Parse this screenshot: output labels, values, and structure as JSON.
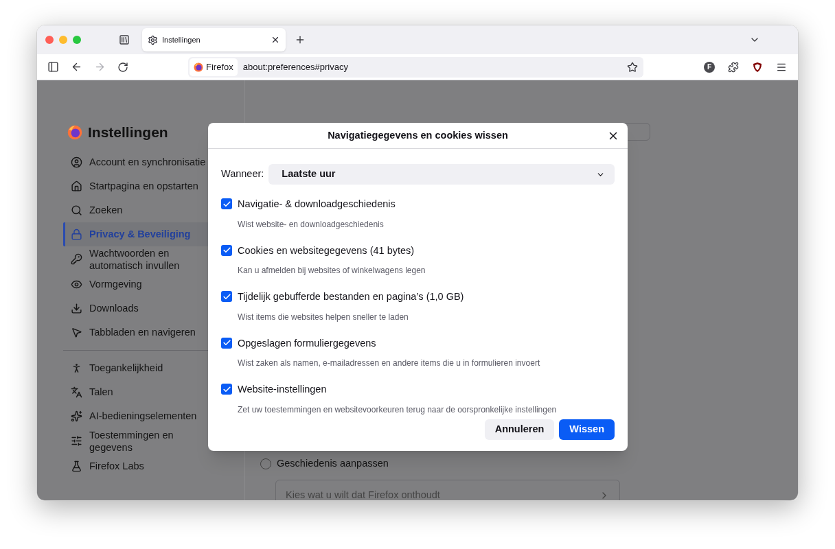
{
  "browser": {
    "tab": {
      "title": "Instellingen"
    },
    "identity": "Firefox",
    "url": "about:preferences#privacy",
    "account_initial": "F"
  },
  "sidebar": {
    "title": "Instellingen",
    "groups": [
      {
        "items": [
          {
            "label": "Account en synchronisatie",
            "selected": false
          },
          {
            "label": "Startpagina en opstarten",
            "selected": false
          },
          {
            "label": "Zoeken",
            "selected": false
          },
          {
            "label": "Privacy & Beveiliging",
            "selected": true
          },
          {
            "label": "Wachtwoorden en automatisch invullen",
            "selected": false
          },
          {
            "label": "Vormgeving",
            "selected": false
          },
          {
            "label": "Downloads",
            "selected": false
          },
          {
            "label": "Tabbladen en navigeren",
            "selected": false
          }
        ]
      },
      {
        "items": [
          {
            "label": "Toegankelijkheid",
            "selected": false
          },
          {
            "label": "Talen",
            "selected": false
          },
          {
            "label": "AI-bedieningselementen",
            "selected": false
          },
          {
            "label": "Toestemmingen en gegevens",
            "selected": false
          },
          {
            "label": "Firefox Labs",
            "selected": false
          }
        ]
      }
    ]
  },
  "content": {
    "radio": {
      "label": "Geschiedenis aanpassen",
      "selected": false
    },
    "link_row": "Kies wat u wilt dat Firefox onthoudt"
  },
  "dialog": {
    "title": "Navigatiegegevens en cookies wissen",
    "when_label": "Wanneer:",
    "when_value": "Laatste uur",
    "options": [
      {
        "label": "Navigatie- & downloadgeschiedenis",
        "description": "Wist website- en downloadgeschiedenis",
        "checked": true
      },
      {
        "label": "Cookies en websitegegevens (41 bytes)",
        "description": "Kan u afmelden bij websites of winkelwagens legen",
        "checked": true
      },
      {
        "label": "Tijdelijk gebufferde bestanden en pagina’s (1,0 GB)",
        "description": "Wist items die websites helpen sneller te laden",
        "checked": true
      },
      {
        "label": "Opgeslagen formuliergegevens",
        "description": "Wist zaken als namen, e-mailadressen en andere items die u in formulieren invoert",
        "checked": true
      },
      {
        "label": "Website-instellingen",
        "description": "Zet uw toestemmingen en websitevoorkeuren terug naar de oorspronkelijke instellingen",
        "checked": true
      }
    ],
    "buttons": [
      {
        "label": "Annuleren",
        "kind": "secondary"
      },
      {
        "label": "Wissen",
        "kind": "primary"
      }
    ]
  }
}
